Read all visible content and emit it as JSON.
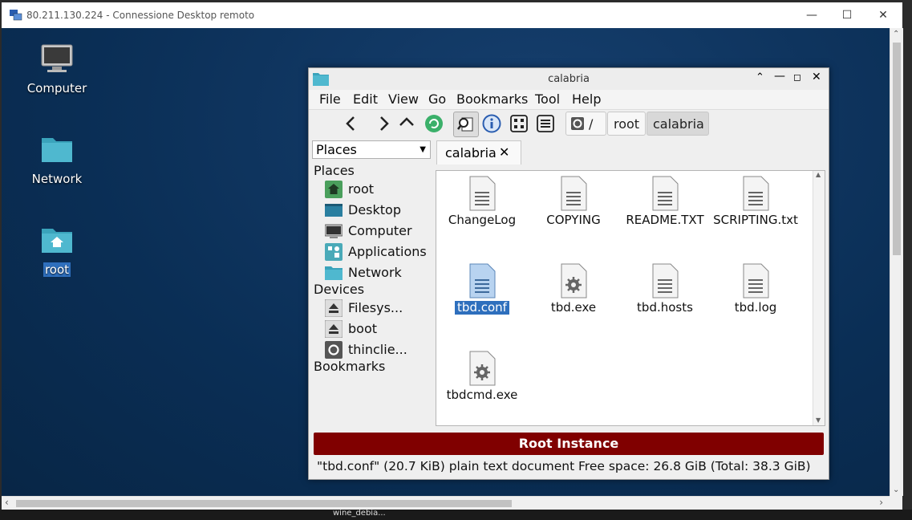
{
  "rdp": {
    "title": "80.211.130.224 - Connessione Desktop remoto",
    "minimize_icon": "minimize-icon",
    "maximize_icon": "maximize-icon",
    "close_icon": "close-icon"
  },
  "desktop": {
    "icons": [
      {
        "label": "Computer",
        "icon": "computer-icon"
      },
      {
        "label": "Network",
        "icon": "folder-icon"
      },
      {
        "label": "root",
        "icon": "home-folder-icon"
      }
    ],
    "taskbar_label": "wine_debia..."
  },
  "file_manager": {
    "title": "calabria",
    "menu": [
      "File",
      "Edit",
      "View",
      "Go",
      "Bookmarks",
      "Tool",
      "Help"
    ],
    "path": {
      "root_glyph": "/",
      "segments": [
        "root",
        "calabria"
      ]
    },
    "places_dropdown": "Places",
    "tab_label": "calabria",
    "sidebar": {
      "places_header": "Places",
      "places": [
        "root",
        "Desktop",
        "Computer",
        "Applications",
        "Network"
      ],
      "devices_header": "Devices",
      "devices": [
        "Filesys...",
        "boot",
        "thinclie..."
      ],
      "bookmarks_header": "Bookmarks"
    },
    "files": [
      {
        "name": "ChangeLog",
        "type": "text"
      },
      {
        "name": "COPYING",
        "type": "text"
      },
      {
        "name": "README.TXT",
        "type": "text"
      },
      {
        "name": "SCRIPTING.txt",
        "type": "text"
      },
      {
        "name": "tbd.conf",
        "type": "text",
        "selected": true
      },
      {
        "name": "tbd.exe",
        "type": "exe"
      },
      {
        "name": "tbd.hosts",
        "type": "text"
      },
      {
        "name": "tbd.log",
        "type": "text"
      },
      {
        "name": "tbdcmd.exe",
        "type": "exe"
      }
    ],
    "root_banner": "Root Instance",
    "status_left": "\"tbd.conf\" (20.7 KiB) plain text document",
    "status_right": "Free space: 26.8 GiB (Total: 38.3 GiB)"
  },
  "colors": {
    "desktop_bg": "#0a2e55",
    "selection": "#2e6fbd",
    "folder": "#4fb8cf",
    "root_banner": "#800000"
  }
}
